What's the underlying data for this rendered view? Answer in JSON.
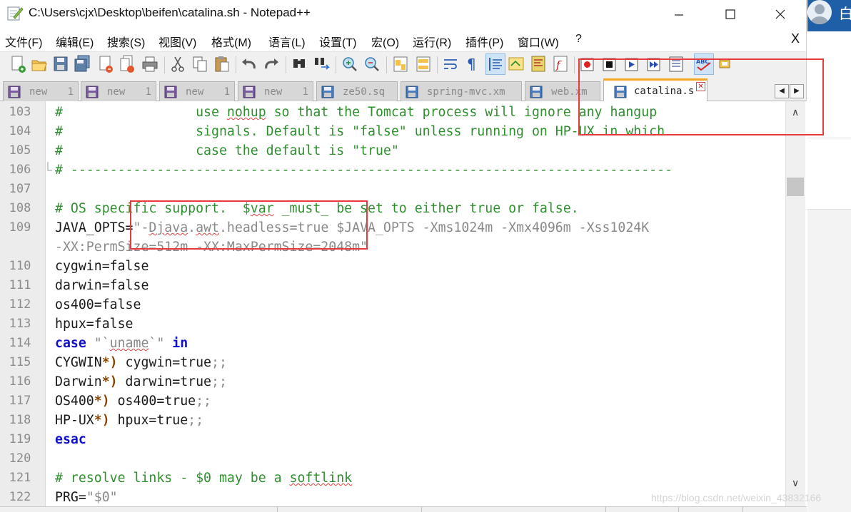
{
  "window": {
    "title": "C:\\Users\\cjx\\Desktop\\beifen\\catalina.sh - Notepad++",
    "controls": {
      "minimize_icon": "minimize-icon",
      "maximize_icon": "maximize-icon",
      "close_icon": "close-icon"
    }
  },
  "menu": {
    "items": [
      "文件(F)",
      "编辑(E)",
      "搜索(S)",
      "视图(V)",
      "格式(M)",
      "语言(L)",
      "设置(T)",
      "宏(O)",
      "运行(R)",
      "插件(P)",
      "窗口(W)",
      "?"
    ],
    "close_label": "X"
  },
  "tabs": [
    {
      "label": "new",
      "suffix": "1",
      "active": false
    },
    {
      "label": "new",
      "suffix": "1",
      "active": false
    },
    {
      "label": "new",
      "suffix": "1",
      "active": false
    },
    {
      "label": "new",
      "suffix": "1",
      "active": false
    },
    {
      "label": "ze50.sq",
      "suffix": "",
      "active": false
    },
    {
      "label": "spring-mvc.xm",
      "suffix": "",
      "active": false
    },
    {
      "label": "web.xm",
      "suffix": "",
      "active": false
    },
    {
      "label": "catalina.s",
      "suffix": "",
      "active": true
    }
  ],
  "tab_nav": {
    "prev": "◀",
    "next": "▶"
  },
  "editor": {
    "lines": [
      {
        "n": "103",
        "segs": [
          [
            "comment",
            "#                 use "
          ],
          [
            "comment-sq",
            "nohup"
          ],
          [
            "comment",
            " so that the Tomcat process will ignore any hangup"
          ]
        ]
      },
      {
        "n": "104",
        "segs": [
          [
            "comment",
            "#                 signals. Default is \"false\" unless running on HP-UX in which"
          ]
        ]
      },
      {
        "n": "105",
        "segs": [
          [
            "comment",
            "#                 case the default is \"true\""
          ]
        ]
      },
      {
        "n": "106",
        "segs": [
          [
            "comment",
            "# -----------------------------------------------------------------------------"
          ]
        ]
      },
      {
        "n": "107",
        "segs": []
      },
      {
        "n": "108",
        "segs": [
          [
            "comment",
            "# OS specific support.  $"
          ],
          [
            "comment-sq",
            "var"
          ],
          [
            "comment",
            " _must_ be set to either true or false."
          ]
        ]
      },
      {
        "n": "109",
        "segs": [
          [
            "default",
            "JAVA_OPTS="
          ],
          [
            "string",
            "\"-"
          ],
          [
            "string-sq",
            "Djava"
          ],
          [
            "string",
            "."
          ],
          [
            "string-sq",
            "awt"
          ],
          [
            "string",
            ".headless=true $JAVA_OPTS -Xms1024m -Xmx4096m -Xss1024K"
          ]
        ]
      },
      {
        "n": "",
        "segs": [
          [
            "string",
            "-XX:PermSize=512m -XX:MaxPermSize=2048m\""
          ]
        ]
      },
      {
        "n": "110",
        "segs": [
          [
            "default",
            "cygwin=false"
          ]
        ]
      },
      {
        "n": "111",
        "segs": [
          [
            "default",
            "darwin=false"
          ]
        ]
      },
      {
        "n": "112",
        "segs": [
          [
            "default",
            "os400=false"
          ]
        ]
      },
      {
        "n": "113",
        "segs": [
          [
            "default",
            "hpux=false"
          ]
        ]
      },
      {
        "n": "114",
        "segs": [
          [
            "keyword",
            "case"
          ],
          [
            "default",
            " "
          ],
          [
            "string",
            "\"`"
          ],
          [
            "string-sq",
            "uname"
          ],
          [
            "string",
            "`\""
          ],
          [
            "default",
            " "
          ],
          [
            "keyword",
            "in"
          ]
        ]
      },
      {
        "n": "115",
        "segs": [
          [
            "default",
            "CYGWIN"
          ],
          [
            "op",
            "*)"
          ],
          [
            "default",
            " cygwin=true"
          ],
          [
            "string",
            ";;"
          ]
        ]
      },
      {
        "n": "116",
        "segs": [
          [
            "default",
            "Darwin"
          ],
          [
            "op",
            "*)"
          ],
          [
            "default",
            " darwin=true"
          ],
          [
            "string",
            ";;"
          ]
        ]
      },
      {
        "n": "117",
        "segs": [
          [
            "default",
            "OS400"
          ],
          [
            "op",
            "*)"
          ],
          [
            "default",
            " os400=true"
          ],
          [
            "string",
            ";;"
          ]
        ]
      },
      {
        "n": "118",
        "segs": [
          [
            "default",
            "HP-UX"
          ],
          [
            "op",
            "*)"
          ],
          [
            "default",
            " hpux=true"
          ],
          [
            "string",
            ";;"
          ]
        ]
      },
      {
        "n": "119",
        "segs": [
          [
            "keyword",
            "esac"
          ]
        ]
      },
      {
        "n": "120",
        "segs": []
      },
      {
        "n": "121",
        "segs": [
          [
            "comment",
            "# resolve links - $0 may be a "
          ],
          [
            "comment-sq",
            "softlink"
          ]
        ]
      },
      {
        "n": "122",
        "segs": [
          [
            "default",
            "PRG="
          ],
          [
            "string",
            "\"$0\""
          ]
        ]
      }
    ]
  },
  "background_app": {
    "label": "白"
  },
  "watermark": "https://blog.csdn.net/weixin_43832166",
  "colors": {
    "annotation": "#e8393c",
    "active_tab_accent": "#f5a623",
    "comment": "#2f8f2f",
    "keyword": "#1010c8"
  }
}
